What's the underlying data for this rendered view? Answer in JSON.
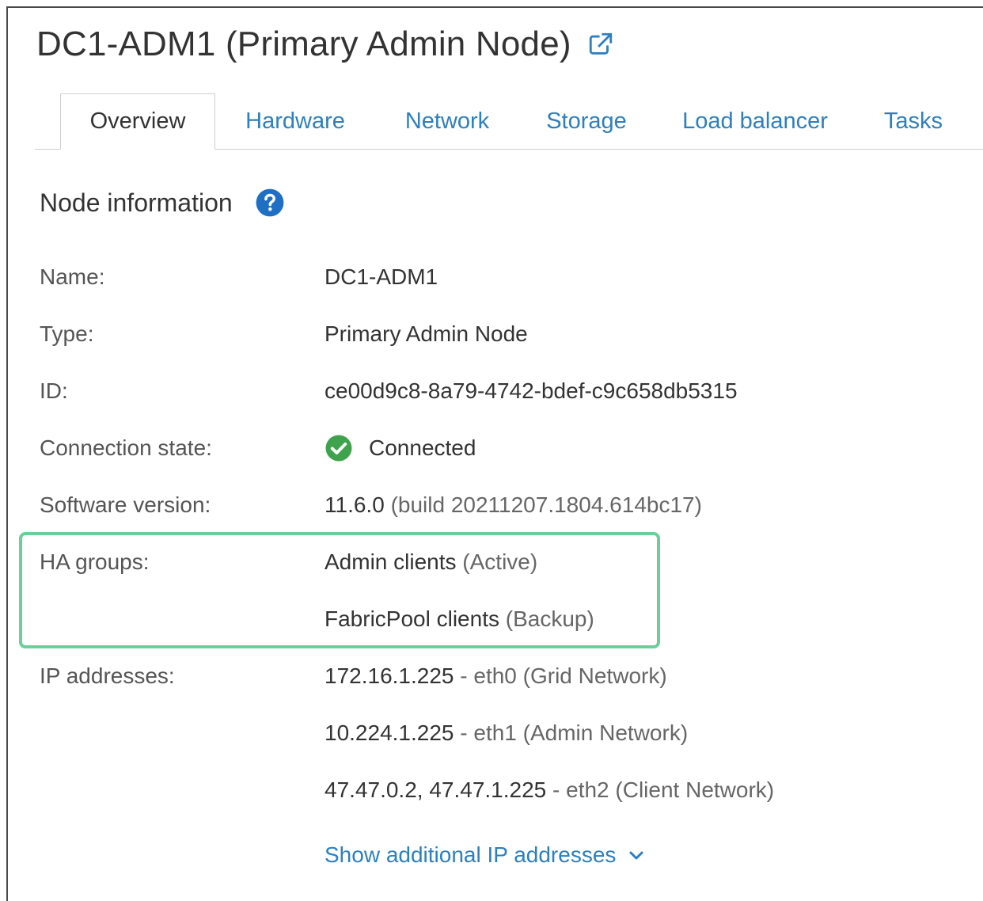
{
  "header": {
    "title": "DC1-ADM1 (Primary Admin Node)"
  },
  "tabs": [
    {
      "label": "Overview",
      "active": true
    },
    {
      "label": "Hardware",
      "active": false
    },
    {
      "label": "Network",
      "active": false
    },
    {
      "label": "Storage",
      "active": false
    },
    {
      "label": "Load balancer",
      "active": false
    },
    {
      "label": "Tasks",
      "active": false
    }
  ],
  "section": {
    "title": "Node information"
  },
  "fields": {
    "name": {
      "label": "Name:",
      "value": "DC1-ADM1"
    },
    "type": {
      "label": "Type:",
      "value": "Primary Admin Node"
    },
    "id": {
      "label": "ID:",
      "value": "ce00d9c8-8a79-4742-bdef-c9c658db5315"
    },
    "connection": {
      "label": "Connection state:",
      "value": "Connected"
    },
    "software": {
      "label": "Software version:",
      "version": "11.6.0",
      "build": "(build 20211207.1804.614bc17)"
    },
    "ha_groups": {
      "label": "HA groups:",
      "items": [
        {
          "name": "Admin clients",
          "role": "(Active)"
        },
        {
          "name": "FabricPool clients",
          "role": "(Backup)"
        }
      ]
    },
    "ip_addresses": {
      "label": "IP addresses:",
      "items": [
        {
          "address": "172.16.1.225",
          "detail": "- eth0 (Grid Network)"
        },
        {
          "address": "10.224.1.225",
          "detail": "- eth1 (Admin Network)"
        },
        {
          "address": "47.47.0.2, 47.47.1.225",
          "detail": "- eth2 (Client Network)"
        }
      ]
    }
  },
  "show_more": {
    "label": "Show additional IP addresses"
  },
  "colors": {
    "link": "#2d7fbf",
    "success": "#3fa34d",
    "highlight": "#6ccf9a",
    "help": "#1f6fc4"
  },
  "icons": {
    "external": "external-link-icon",
    "help": "help-icon",
    "status": "check-circle-icon",
    "expand": "chevron-down-icon"
  }
}
